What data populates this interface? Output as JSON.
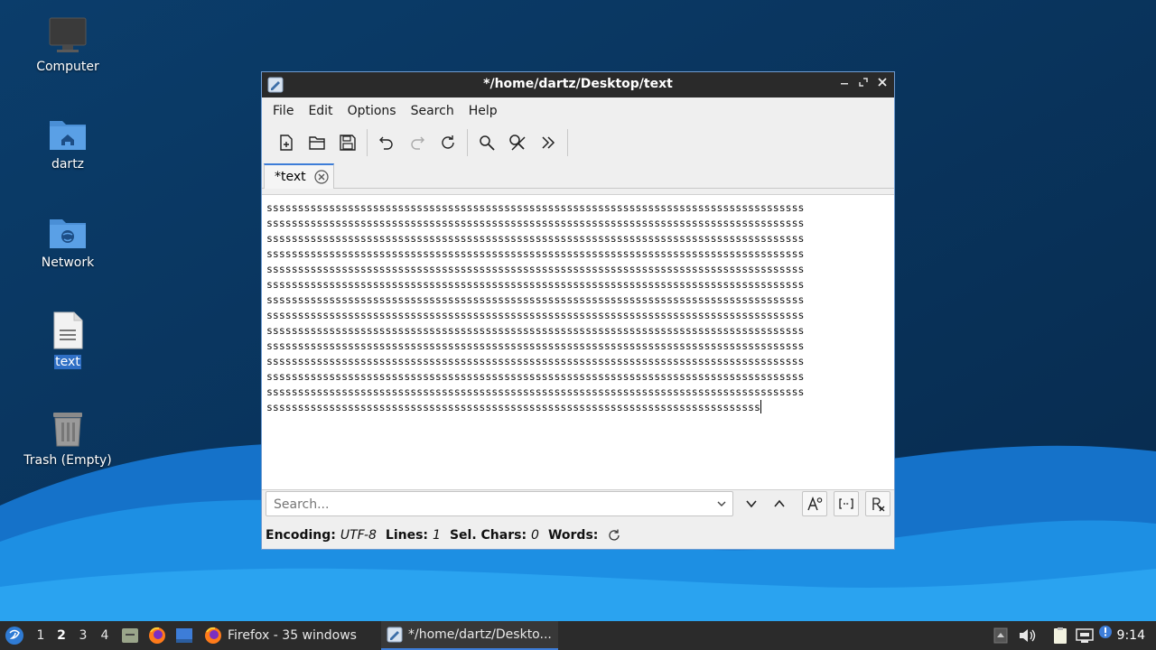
{
  "desktop": {
    "icons": [
      {
        "label": "Computer",
        "icon": "computer-icon"
      },
      {
        "label": "dartz",
        "icon": "home-folder-icon"
      },
      {
        "label": "Network",
        "icon": "network-folder-icon"
      },
      {
        "label": "text",
        "icon": "text-file-icon",
        "selected": true
      },
      {
        "label": "Trash (Empty)",
        "icon": "trash-icon"
      }
    ]
  },
  "window": {
    "title": "*/home/dartz/Desktop/text",
    "menu": [
      "File",
      "Edit",
      "Options",
      "Search",
      "Help"
    ],
    "toolbar": [
      "new-file-icon",
      "open-file-icon",
      "save-icon",
      "undo-icon",
      "redo-icon",
      "reload-icon",
      "find-icon",
      "replace-icon",
      "more-icon"
    ],
    "tab_label": "*text",
    "editor": {
      "lines": [
        "ssssssssssssssssssssssssssssssssssssssssssssssssssssssssssssssssssssssssssssssssssssss",
        "ssssssssssssssssssssssssssssssssssssssssssssssssssssssssssssssssssssssssssssssssssssss",
        "ssssssssssssssssssssssssssssssssssssssssssssssssssssssssssssssssssssssssssssssssssssss",
        "ssssssssssssssssssssssssssssssssssssssssssssssssssssssssssssssssssssssssssssssssssssss",
        "ssssssssssssssssssssssssssssssssssssssssssssssssssssssssssssssssssssssssssssssssssssss",
        "ssssssssssssssssssssssssssssssssssssssssssssssssssssssssssssssssssssssssssssssssssssss",
        "ssssssssssssssssssssssssssssssssssssssssssssssssssssssssssssssssssssssssssssssssssssss",
        "ssssssssssssssssssssssssssssssssssssssssssssssssssssssssssssssssssssssssssssssssssssss",
        "ssssssssssssssssssssssssssssssssssssssssssssssssssssssssssssssssssssssssssssssssssssss",
        "ssssssssssssssssssssssssssssssssssssssssssssssssssssssssssssssssssssssssssssssssssssss",
        "ssssssssssssssssssssssssssssssssssssssssssssssssssssssssssssssssssssssssssssssssssssss",
        "ssssssssssssssssssssssssssssssssssssssssssssssssssssssssssssssssssssssssssssssssssssss",
        "ssssssssssssssssssssssssssssssssssssssssssssssssssssssssssssssssssssssssssssssssssssss",
        "sssssssssssssssssssssssssssssssssssssssssssssssssssssssssssssssssssssssssssssss"
      ]
    },
    "search": {
      "placeholder": "Search..."
    },
    "status": {
      "encoding_label": "Encoding:",
      "encoding_value": "UTF-8",
      "lines_label": "Lines:",
      "lines_value": "1",
      "sel_label": "Sel. Chars:",
      "sel_value": "0",
      "words_label": "Words:"
    }
  },
  "taskbar": {
    "workspaces": [
      "1",
      "2",
      "3",
      "4"
    ],
    "active_workspace": "2",
    "tasks": [
      {
        "label": "Firefox - 35 windows",
        "icon": "firefox-icon"
      },
      {
        "label": "*/home/dartz/Deskto...",
        "icon": "text-editor-icon",
        "active": true
      }
    ],
    "clock": "9:14"
  },
  "colors": {
    "accent": "#3d7dd8",
    "titlebar": "#2a2a2a",
    "taskbar": "#2b2b2b",
    "desktop": "#0c3a66"
  }
}
